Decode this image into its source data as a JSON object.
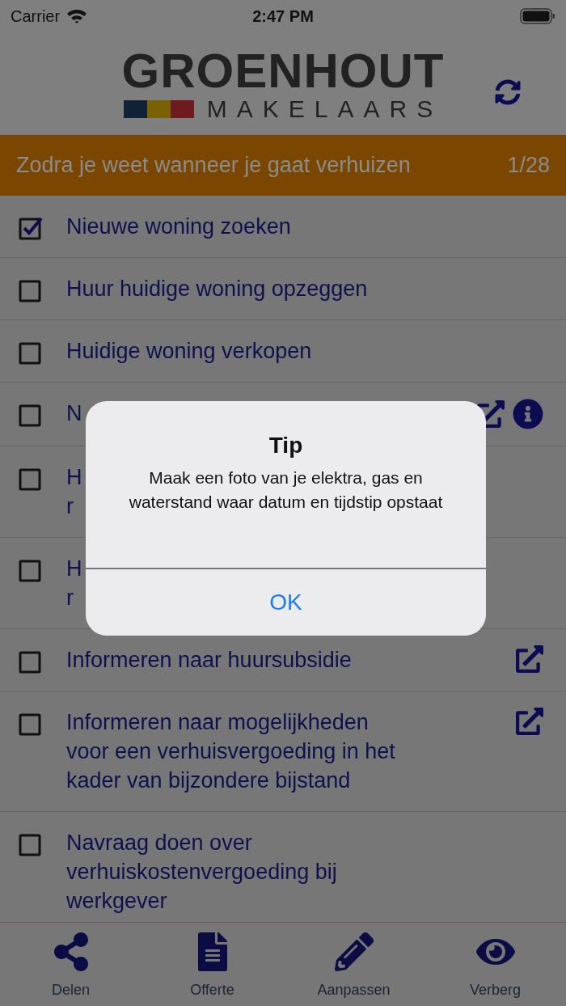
{
  "status_bar": {
    "carrier": "Carrier",
    "time": "2:47 PM"
  },
  "header": {
    "logo_title": "GROENHOUT",
    "logo_subtitle": "MAKELAARS"
  },
  "section": {
    "title": "Zodra je weet wanneer je gaat verhuizen",
    "count": "1/28"
  },
  "tasks": [
    {
      "lines": [
        "Nieuwe woning zoeken"
      ],
      "checked": true,
      "external_link": false,
      "info": false
    },
    {
      "lines": [
        "Huur huidige woning opzeggen"
      ],
      "checked": false,
      "external_link": false,
      "info": false
    },
    {
      "lines": [
        "Huidige woning verkopen"
      ],
      "checked": false,
      "external_link": false,
      "info": false
    },
    {
      "lines": [
        "N"
      ],
      "checked": false,
      "external_link": true,
      "info": true
    },
    {
      "lines": [
        "H",
        "r"
      ],
      "checked": false,
      "external_link": false,
      "info": false
    },
    {
      "lines": [
        "H",
        "r"
      ],
      "checked": false,
      "external_link": false,
      "info": false
    },
    {
      "lines": [
        "Informeren naar huursubsidie"
      ],
      "checked": false,
      "external_link": true,
      "info": false
    },
    {
      "lines": [
        "Informeren naar mogelijkheden",
        "voor een verhuisvergoeding in het",
        "kader van bijzondere bijstand"
      ],
      "checked": false,
      "external_link": true,
      "info": false
    },
    {
      "lines": [
        "Navraag doen over",
        "verhuiskostenvergoeding bij",
        "werkgever"
      ],
      "checked": false,
      "external_link": false,
      "info": false
    }
  ],
  "tab_bar": [
    {
      "kind": "share",
      "label": "Delen"
    },
    {
      "kind": "document",
      "label": "Offerte"
    },
    {
      "kind": "pencil",
      "label": "Aanpassen"
    },
    {
      "kind": "eye",
      "label": "Verberg"
    }
  ],
  "alert": {
    "title": "Tip",
    "message": "Maak een foto van je elektra, gas en waterstand waar datum en tijdstip opstaat",
    "button": "OK"
  }
}
